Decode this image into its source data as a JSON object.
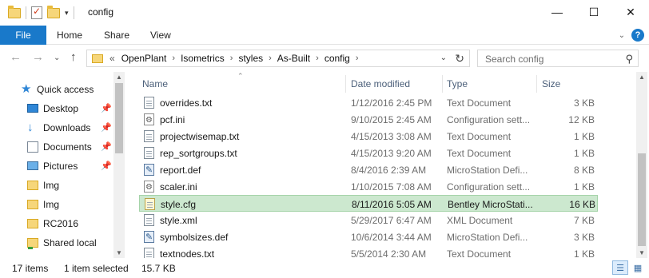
{
  "window": {
    "title": "config",
    "controls": {
      "minimize": "—",
      "maximize": "☐",
      "close": "✕"
    }
  },
  "ribbon": {
    "file": "File",
    "tabs": [
      "Home",
      "Share",
      "View"
    ],
    "expand_glyph": "⌄",
    "help_glyph": "?"
  },
  "nav_buttons": {
    "back": "←",
    "forward": "→",
    "recent": "⌄",
    "up": "↑"
  },
  "address": {
    "prefix": "«",
    "crumbs": [
      "OpenPlant",
      "Isometrics",
      "styles",
      "As-Built",
      "config"
    ],
    "separator": "›",
    "dropdown_glyph": "⌄",
    "refresh_glyph": "↻"
  },
  "search": {
    "placeholder": "Search config",
    "icon": "⚲"
  },
  "navpane": {
    "items": [
      {
        "label": "Quick access",
        "icon": "star-icon",
        "pinned": false
      },
      {
        "label": "Desktop",
        "icon": "desktop-icon",
        "pinned": true
      },
      {
        "label": "Downloads",
        "icon": "download-icon",
        "pinned": true
      },
      {
        "label": "Documents",
        "icon": "documents-icon",
        "pinned": true
      },
      {
        "label": "Pictures",
        "icon": "pictures-icon",
        "pinned": true
      },
      {
        "label": "Img",
        "icon": "folder-icon",
        "pinned": false
      },
      {
        "label": "Img",
        "icon": "folder-icon",
        "pinned": false
      },
      {
        "label": "RC2016",
        "icon": "folder-icon",
        "pinned": false
      },
      {
        "label": "Shared local",
        "icon": "shared-folder-icon",
        "pinned": false
      }
    ],
    "pin_glyph": "📌"
  },
  "columns": {
    "name": "Name",
    "date": "Date modified",
    "type": "Type",
    "size": "Size"
  },
  "files": [
    {
      "name": "overrides.txt",
      "date": "1/12/2016 2:45 PM",
      "type": "Text Document",
      "size": "3 KB",
      "icon": "txt"
    },
    {
      "name": "pcf.ini",
      "date": "9/10/2015 2:45 AM",
      "type": "Configuration sett...",
      "size": "12 KB",
      "icon": "ini"
    },
    {
      "name": "projectwisemap.txt",
      "date": "4/15/2013 3:08 AM",
      "type": "Text Document",
      "size": "1 KB",
      "icon": "txt"
    },
    {
      "name": "rep_sortgroups.txt",
      "date": "4/15/2013 9:20 AM",
      "type": "Text Document",
      "size": "1 KB",
      "icon": "txt"
    },
    {
      "name": "report.def",
      "date": "8/4/2016 2:39 AM",
      "type": "MicroStation Defi...",
      "size": "8 KB",
      "icon": "ms"
    },
    {
      "name": "scaler.ini",
      "date": "1/10/2015 7:08 AM",
      "type": "Configuration sett...",
      "size": "1 KB",
      "icon": "ini"
    },
    {
      "name": "style.cfg",
      "date": "8/11/2016 5:05 AM",
      "type": "Bentley MicroStati...",
      "size": "16 KB",
      "icon": "cfg",
      "selected": true
    },
    {
      "name": "style.xml",
      "date": "5/29/2017 6:47 AM",
      "type": "XML Document",
      "size": "7 KB",
      "icon": "txt"
    },
    {
      "name": "symbolsizes.def",
      "date": "10/6/2014 3:44 AM",
      "type": "MicroStation Defi...",
      "size": "3 KB",
      "icon": "ms"
    },
    {
      "name": "textnodes.txt",
      "date": "5/5/2014 2:30 AM",
      "type": "Text Document",
      "size": "1 KB",
      "icon": "txt"
    }
  ],
  "status": {
    "item_count": "17 items",
    "selection": "1 item selected",
    "selection_size": "15.7 KB"
  },
  "colors": {
    "file_tab": "#1979ca",
    "selected_row": "#cce8cf",
    "folder": "#f6d67a",
    "accent_icon": "#2f86d6"
  }
}
